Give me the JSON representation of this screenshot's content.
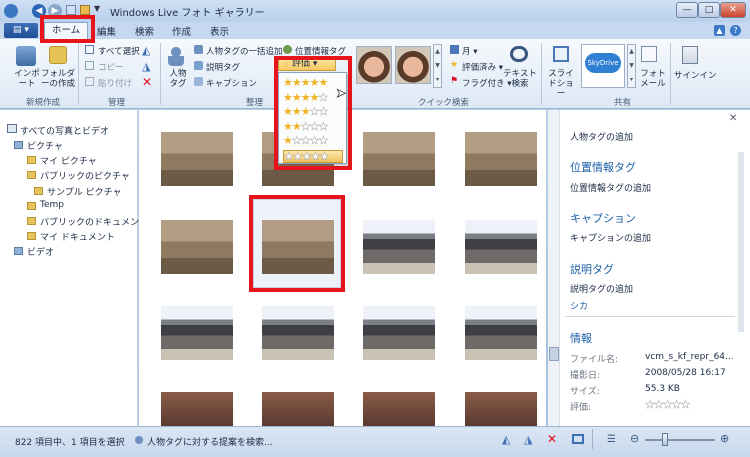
{
  "window": {
    "title": "Windows Live フォト ギャラリー"
  },
  "tabs": [
    "ホーム",
    "編集",
    "検索",
    "作成",
    "表示"
  ],
  "ribbon": {
    "new_import": "インポート",
    "new_folder": "フォルダーの作成",
    "select_all": "すべて選択",
    "copy": "コピー",
    "paste": "貼り付け",
    "person_tag": "人物タグ",
    "person_tag_bulk": "人物タグの一括追加",
    "caption_tag": "説明タグ",
    "caption": "キャプション",
    "geo_tag": "位置情報タグ",
    "rating_label": "評価",
    "month": "月",
    "rated": "評価済み",
    "flagged": "フラグ付き",
    "text_search": "テキスト検索",
    "slideshow": "スライドショー",
    "skydrive": "SkyDrive",
    "photo_mail": "フォトメール",
    "sign_in": "サインイン",
    "groups": {
      "new": "新規作成",
      "manage": "管理",
      "organize": "整理",
      "quick_search": "クイック検索",
      "share": "共有"
    }
  },
  "rating_options": [
    5,
    4,
    3,
    2,
    1,
    0
  ],
  "tree": {
    "root": "すべての写真とビデオ",
    "items": [
      {
        "label": "ピクチャ",
        "level": 1
      },
      {
        "label": "マイ ピクチャ",
        "level": 2
      },
      {
        "label": "パブリックのピクチャ",
        "level": 2
      },
      {
        "label": "サンプル ピクチャ",
        "level": 3
      },
      {
        "label": "Temp",
        "level": 2
      },
      {
        "label": "パブリックのドキュメント",
        "level": 2
      },
      {
        "label": "マイ ドキュメント",
        "level": 2
      },
      {
        "label": "ビデオ",
        "level": 1
      }
    ]
  },
  "details": {
    "person_tag_add": "人物タグの追加",
    "geo_header": "位置情報タグ",
    "geo_add": "位置情報タグの追加",
    "caption_header": "キャプション",
    "caption_add": "キャプションの追加",
    "desc_header": "説明タグ",
    "desc_add": "説明タグの追加",
    "desc_value": "シカ",
    "info_header": "情報",
    "filename_label": "ファイル名:",
    "filename_value": "vcm_s_kf_repr_64...",
    "date_label": "撮影日:",
    "date_value": "2008/05/28  16:17",
    "size_label": "サイズ:",
    "size_value": "55.3 KB",
    "rating_label": "評価:",
    "rating_value": 0
  },
  "status": {
    "count": "822 項目中、1 項目を選択",
    "suggest": "人物タグに対する提案を検索..."
  }
}
